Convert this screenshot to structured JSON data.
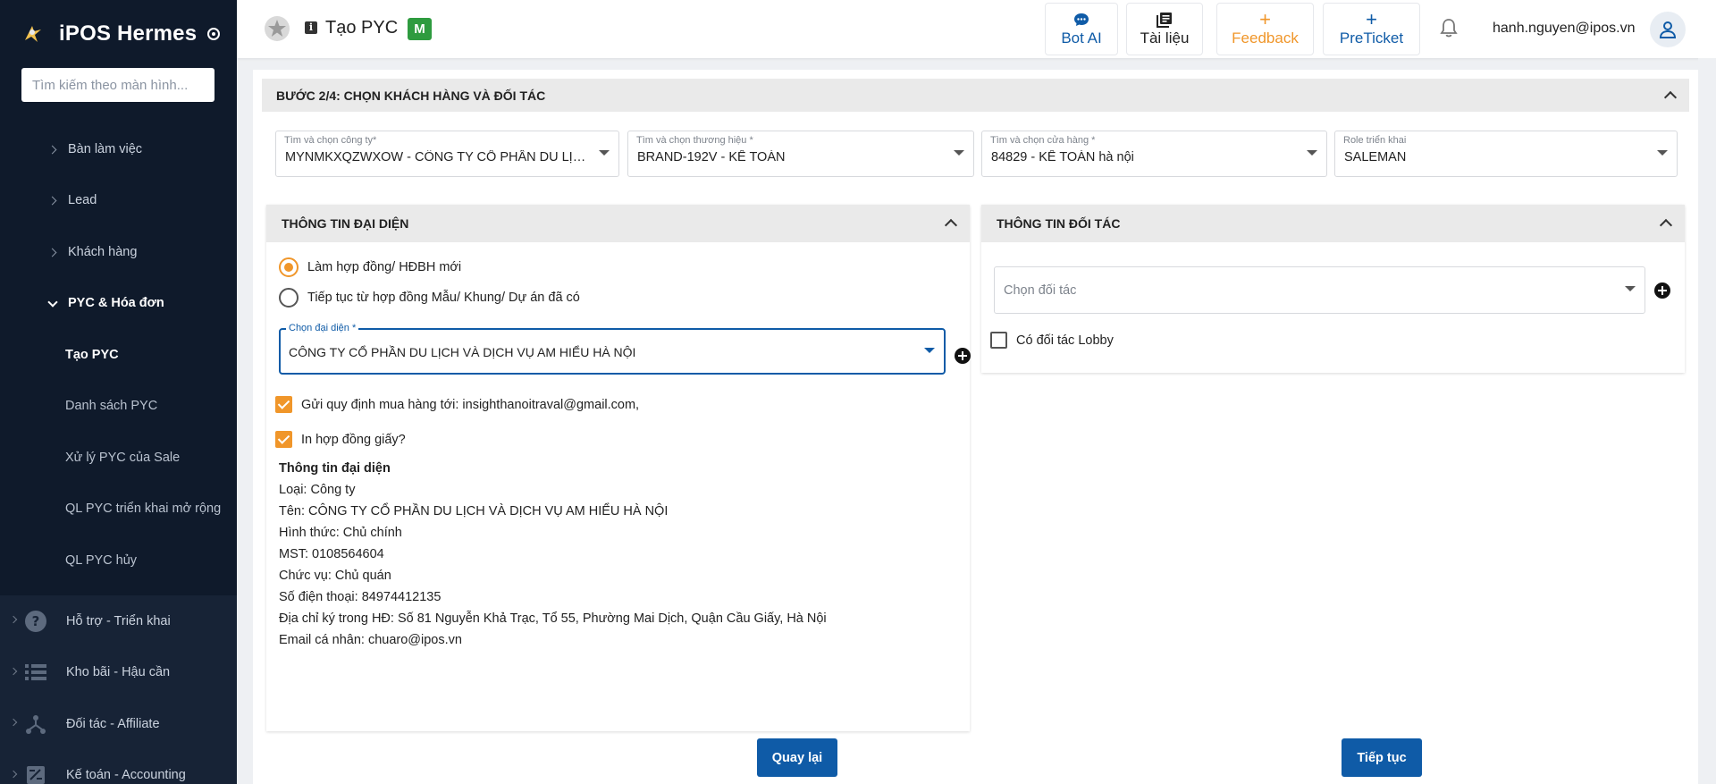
{
  "sidebar": {
    "brand": "iPOS Hermes",
    "search_placeholder": "Tìm kiếm theo màn hình...",
    "sub_items": [
      {
        "label": "Bàn làm việc"
      },
      {
        "label": "Lead"
      },
      {
        "label": "Khách hàng"
      }
    ],
    "open_group": "PYC & Hóa đơn",
    "children": [
      {
        "label": "Tạo PYC",
        "active": true
      },
      {
        "label": "Danh sách PYC"
      },
      {
        "label": "Xử lý PYC của Sale"
      },
      {
        "label": "QL PYC triển khai mở rộng"
      },
      {
        "label": "QL PYC hủy"
      }
    ],
    "main_items": [
      {
        "label": "Hỗ trợ - Triển khai",
        "icon": "help-circle-icon"
      },
      {
        "label": "Kho bãi - Hậu cần",
        "icon": "list-icon"
      },
      {
        "label": "Đối tác - Affiliate",
        "icon": "network-icon"
      },
      {
        "label": "Kế toán - Accounting",
        "icon": "accounting-icon"
      }
    ]
  },
  "header": {
    "title": "Tạo PYC",
    "badge": "M",
    "buttons": {
      "bot_ai": "Bot AI",
      "docs": "Tài liệu",
      "feedback": "Feedback",
      "preticket": "PreTicket"
    },
    "user_email": "hanh.nguyen@ipos.vn"
  },
  "step": {
    "title": "BƯỚC 2/4: CHỌN KHÁCH HÀNG VÀ ĐỐI TÁC"
  },
  "filters": [
    {
      "label": "Tìm và chọn công ty*",
      "value": "MYNMKXQZWXOW - CÔNG TY CỔ PHẦN DU LỊCH V..."
    },
    {
      "label": "Tìm và chọn thương hiệu *",
      "value": "BRAND-192V - KẾ TOÁN"
    },
    {
      "label": "Tìm và chọn cửa hàng *",
      "value": "84829 - KẾ TOÁN hà nội"
    },
    {
      "label": "Role triển khai",
      "value": "SALEMAN"
    }
  ],
  "representative": {
    "panel_title": "THÔNG TIN ĐẠI DIỆN",
    "radio_new": "Làm hợp đồng/ HĐBH mới",
    "radio_continue": "Tiếp tục từ hợp đồng Mẫu/ Khung/ Dự án đã có",
    "select_label": "Chọn đại diện *",
    "select_value": "CÔNG TY CỔ PHẦN DU LỊCH VÀ DỊCH VỤ AM HIỂU HÀ NỘI",
    "check_send": "Gửi quy định mua hàng tới: insighthanoitraval@gmail.com,",
    "check_print": "In hợp đồng giấy?",
    "info_title": "Thông tin đại diện",
    "info_lines": [
      "Loại: Công ty",
      "Tên: CÔNG TY CỔ PHẦN DU LỊCH VÀ DỊCH VỤ AM HIỂU HÀ NỘI",
      "Hình thức: Chủ chính",
      "MST: 0108564604",
      "Chức vụ: Chủ quán",
      "Số điện thoại: 84974412135",
      "Địa chỉ ký trong HĐ: Số 81 Nguyễn Khả Trạc, Tổ 55, Phường Mai Dịch, Quận Cầu Giấy, Hà Nội",
      "Email cá nhân: chuaro@ipos.vn"
    ]
  },
  "partner": {
    "panel_title": "THÔNG TIN ĐỐI TÁC",
    "select_placeholder": "Chọn đối tác",
    "lobby_label": "Có đối tác Lobby"
  },
  "actions": {
    "back": "Quay lại",
    "next": "Tiếp tục"
  },
  "colors": {
    "sidebar_bg": "#0f1a2b",
    "primary": "#0f5ba7",
    "accent_orange": "#f0962a",
    "badge_green": "#2e9b3f"
  }
}
